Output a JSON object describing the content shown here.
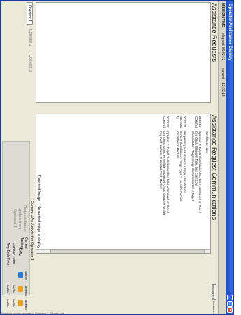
{
  "window": {
    "title": "Operator Assistance Display",
    "buttons": {
      "minimize": "_",
      "maximize": "□",
      "close": "×"
    }
  },
  "status": {
    "mission_time_label": "MISSION TIME",
    "elapsed_label": "elapsed",
    "elapsed_value": "00:02:12",
    "current_label": "current",
    "current_value": "12:02:12"
  },
  "assistance_requests": {
    "title": "Assistance Requests",
    "items": []
  },
  "communications": {
    "title": "Assistance Request Communications",
    "disconnect_label": "Disconnect",
    "connected_label": "Connected",
    "entries": [
      {
        "time": "",
        "text": "Confidence: Low"
      },
      {
        "time": "00:03:19 [Comms]",
        "text": "Operator 3: Target classification has been completed for UAV 7\nOrg Class: Unknown Tank, Org Conf: Low\nClassification: Target Image does not contain a target"
      },
      {
        "time": "00:02:24 [Operator 3]",
        "text": "Requesting assistance on a target classification.\nCurrent classification: Target Type 7: Launcher Vehicle\nConfidence: Medium"
      },
      {
        "time": "00:02:27 [Comms]",
        "text": "Operator 3: Target classification has been completed for UAV 6\nOrg Class: Launcher Vehicle, Submitted Class: Launcher Vehicle\nOrg Conf: Medium, Submitted Conf: Medium"
      }
    ]
  },
  "request_status": {
    "text": "Request Status\nUpdate from\nOperator 1"
  },
  "operator_tabs": [
    {
      "label": "Operator 1",
      "active": true
    },
    {
      "label": "Operator 2",
      "active": false
    },
    {
      "label": "Operator 3",
      "active": false
    }
  ],
  "received_image": {
    "label": "Received Image:",
    "value": "No current image to display"
  },
  "uav_activity": {
    "title": "Current UAV Activity for Operator 1",
    "rows": {
      "current_tasking": "Current Tasking:",
      "uav": "UAV:",
      "elapsed_time": "Elapsed Time:",
      "avg_task_time": "Avg Task Time:"
    },
    "columns": [
      {
        "tasking": "Search",
        "uav_color": "#2a7ad8",
        "elapsed": "",
        "avg": ""
      },
      {
        "tasking": "Target ID",
        "uav_color": "#e8a21e",
        "elapsed": "0m28s",
        "avg": "0m30s"
      },
      {
        "tasking": "Target ID",
        "uav_color": "#e8a21e",
        "elapsed": "0m19s",
        "avg": "0m30s"
      }
    ]
  },
  "footer": {
    "text": "Sending update request to Operator 1. Please wait..."
  }
}
